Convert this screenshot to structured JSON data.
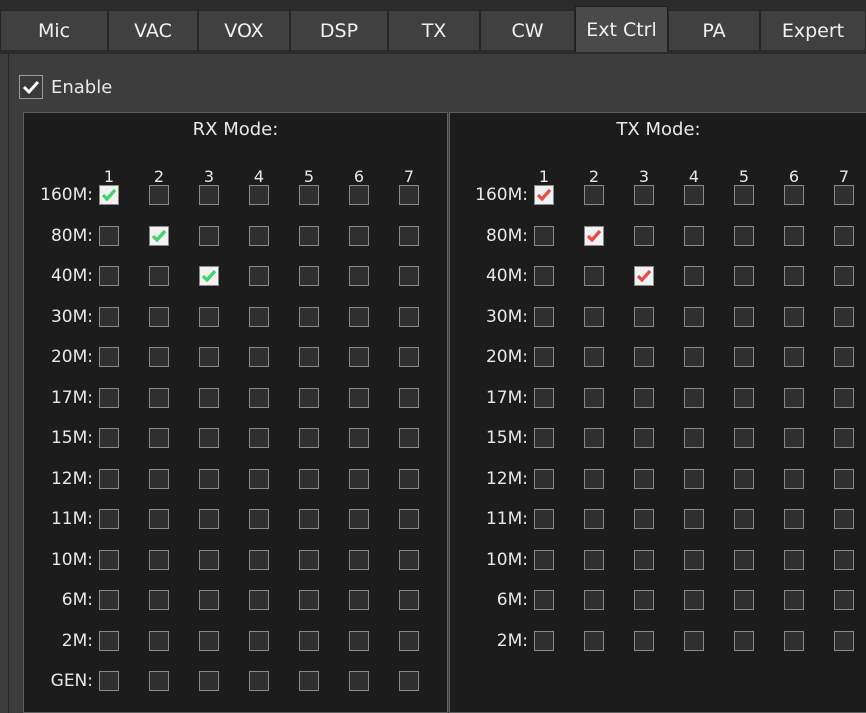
{
  "tabs": [
    {
      "label": "Mic",
      "active": false
    },
    {
      "label": "VAC",
      "active": false
    },
    {
      "label": "VOX",
      "active": false
    },
    {
      "label": "DSP",
      "active": false
    },
    {
      "label": "TX",
      "active": false
    },
    {
      "label": "CW",
      "active": false
    },
    {
      "label": "Ext Ctrl",
      "active": true
    },
    {
      "label": "PA",
      "active": false
    },
    {
      "label": "Expert",
      "active": false
    }
  ],
  "enable": {
    "label": "Enable",
    "checked": true
  },
  "colors": {
    "rx_check": "#3fd46a",
    "tx_check": "#e84a4a"
  },
  "rx": {
    "title": "RX Mode:",
    "columns": [
      "1",
      "2",
      "3",
      "4",
      "5",
      "6",
      "7"
    ],
    "rows": [
      {
        "label": "160M:",
        "checked": [
          true,
          false,
          false,
          false,
          false,
          false,
          false
        ]
      },
      {
        "label": "80M:",
        "checked": [
          false,
          true,
          false,
          false,
          false,
          false,
          false
        ]
      },
      {
        "label": "40M:",
        "checked": [
          false,
          false,
          true,
          false,
          false,
          false,
          false
        ]
      },
      {
        "label": "30M:",
        "checked": [
          false,
          false,
          false,
          false,
          false,
          false,
          false
        ]
      },
      {
        "label": "20M:",
        "checked": [
          false,
          false,
          false,
          false,
          false,
          false,
          false
        ]
      },
      {
        "label": "17M:",
        "checked": [
          false,
          false,
          false,
          false,
          false,
          false,
          false
        ]
      },
      {
        "label": "15M:",
        "checked": [
          false,
          false,
          false,
          false,
          false,
          false,
          false
        ]
      },
      {
        "label": "12M:",
        "checked": [
          false,
          false,
          false,
          false,
          false,
          false,
          false
        ]
      },
      {
        "label": "11M:",
        "checked": [
          false,
          false,
          false,
          false,
          false,
          false,
          false
        ]
      },
      {
        "label": "10M:",
        "checked": [
          false,
          false,
          false,
          false,
          false,
          false,
          false
        ]
      },
      {
        "label": "6M:",
        "checked": [
          false,
          false,
          false,
          false,
          false,
          false,
          false
        ]
      },
      {
        "label": "2M:",
        "checked": [
          false,
          false,
          false,
          false,
          false,
          false,
          false
        ]
      },
      {
        "label": "GEN:",
        "checked": [
          false,
          false,
          false,
          false,
          false,
          false,
          false
        ]
      }
    ]
  },
  "tx": {
    "title": "TX Mode:",
    "columns": [
      "1",
      "2",
      "3",
      "4",
      "5",
      "6",
      "7"
    ],
    "rows": [
      {
        "label": "160M:",
        "checked": [
          true,
          false,
          false,
          false,
          false,
          false,
          false
        ]
      },
      {
        "label": "80M:",
        "checked": [
          false,
          true,
          false,
          false,
          false,
          false,
          false
        ]
      },
      {
        "label": "40M:",
        "checked": [
          false,
          false,
          true,
          false,
          false,
          false,
          false
        ]
      },
      {
        "label": "30M:",
        "checked": [
          false,
          false,
          false,
          false,
          false,
          false,
          false
        ]
      },
      {
        "label": "20M:",
        "checked": [
          false,
          false,
          false,
          false,
          false,
          false,
          false
        ]
      },
      {
        "label": "17M:",
        "checked": [
          false,
          false,
          false,
          false,
          false,
          false,
          false
        ]
      },
      {
        "label": "15M:",
        "checked": [
          false,
          false,
          false,
          false,
          false,
          false,
          false
        ]
      },
      {
        "label": "12M:",
        "checked": [
          false,
          false,
          false,
          false,
          false,
          false,
          false
        ]
      },
      {
        "label": "11M:",
        "checked": [
          false,
          false,
          false,
          false,
          false,
          false,
          false
        ]
      },
      {
        "label": "10M:",
        "checked": [
          false,
          false,
          false,
          false,
          false,
          false,
          false
        ]
      },
      {
        "label": "6M:",
        "checked": [
          false,
          false,
          false,
          false,
          false,
          false,
          false
        ]
      },
      {
        "label": "2M:",
        "checked": [
          false,
          false,
          false,
          false,
          false,
          false,
          false
        ]
      }
    ]
  }
}
